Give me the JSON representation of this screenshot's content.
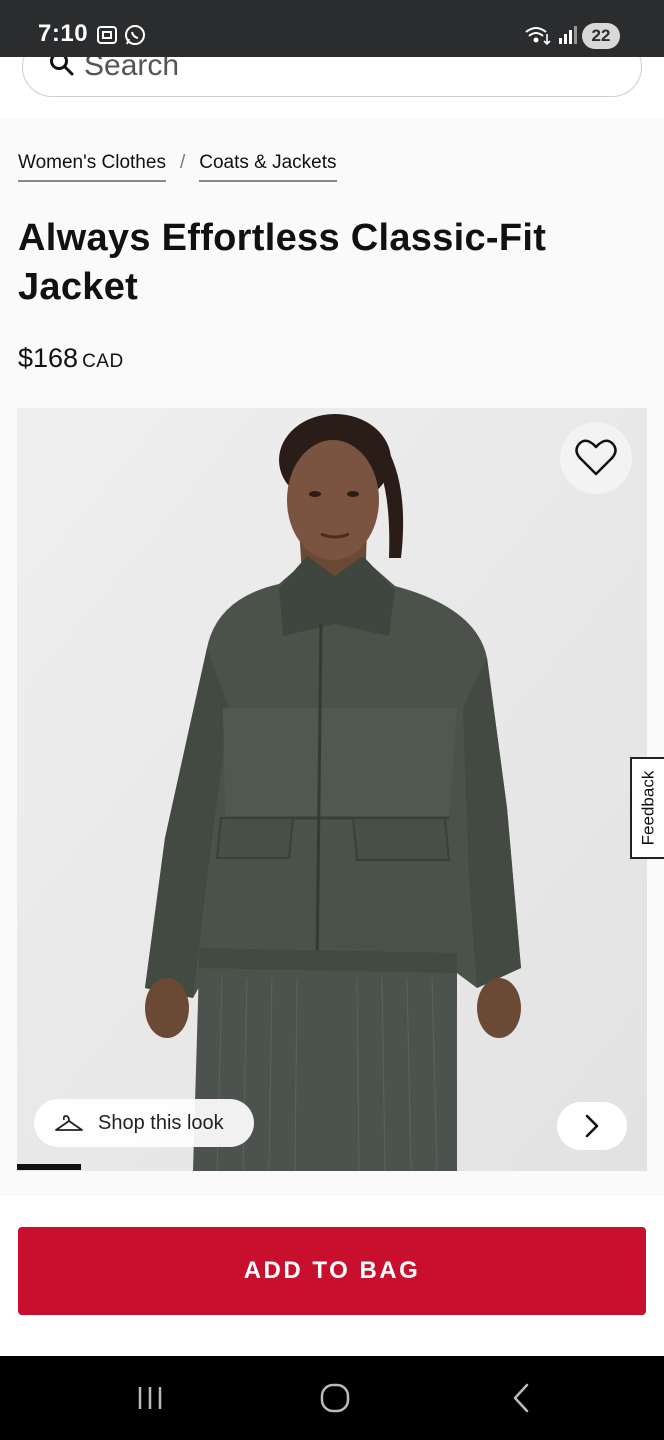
{
  "status_bar": {
    "time": "7:10",
    "battery": "22",
    "icons": [
      "screenshot-icon",
      "whatsapp-icon",
      "wifi-icon",
      "signal-icon"
    ]
  },
  "search": {
    "placeholder": "Search"
  },
  "breadcrumb": {
    "items": [
      "Women's Clothes",
      "Coats & Jackets"
    ],
    "separator": "/"
  },
  "product": {
    "title": "Always Effortless Classic-Fit Jacket",
    "price": "$168",
    "currency": "CAD",
    "image_alt": "Model wearing dark green jacket",
    "shop_look_label": "Shop this look"
  },
  "feedback_label": "Feedback",
  "actions": {
    "add_to_bag_label": "ADD TO BAG"
  },
  "colors": {
    "accent": "#c8102e",
    "status_bar": "#2b2c2e",
    "jacket": "#4a5249"
  },
  "nav_bar": {
    "buttons": [
      "recent-apps-icon",
      "home-icon",
      "back-icon"
    ]
  }
}
